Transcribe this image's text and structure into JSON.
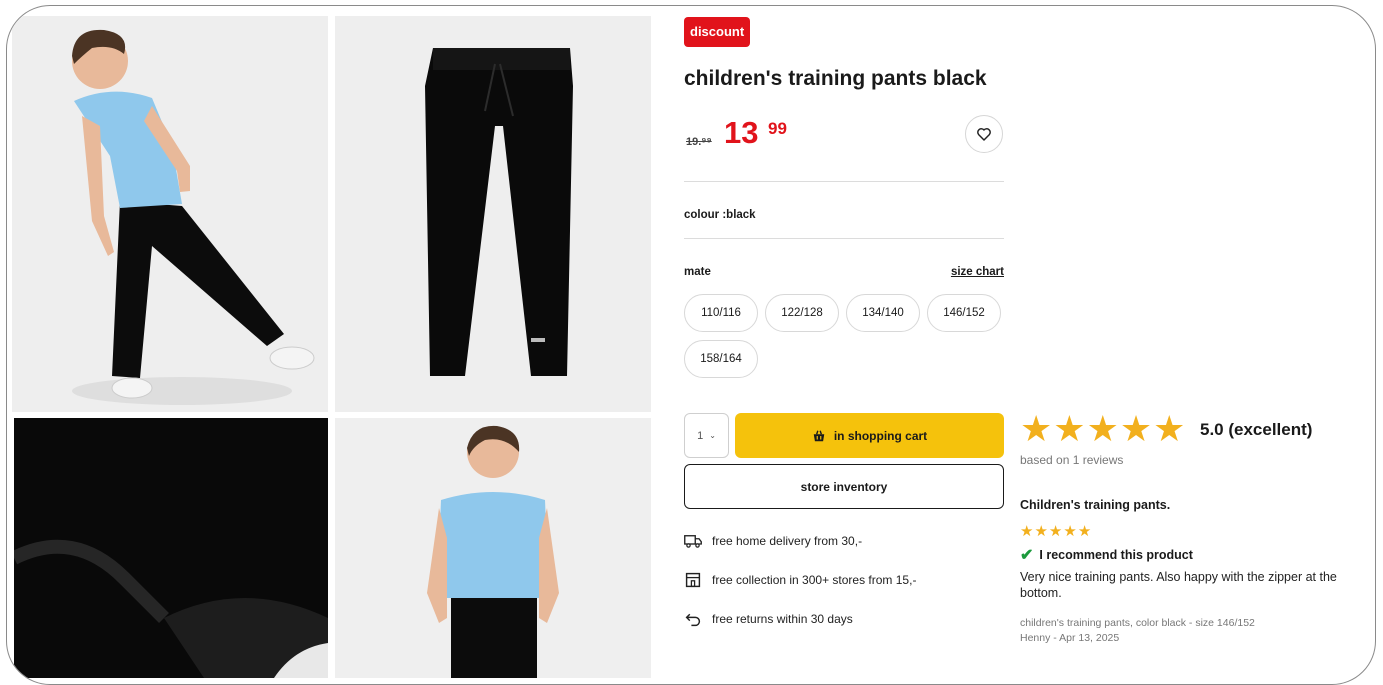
{
  "product": {
    "badge": "discount",
    "title": "children's training pants black",
    "price_old": "19.⁹⁹",
    "price_main": "13",
    "price_cents": "99",
    "favorite_icon": "heart-icon",
    "colour_label": "colour :black",
    "size_label": "mate",
    "size_chart": "size chart",
    "sizes": [
      "110/116",
      "122/128",
      "134/140",
      "146/152",
      "158/164"
    ],
    "quantity": "1",
    "cart_button": "in shopping cart",
    "store_button": "store inventory",
    "perks": [
      {
        "icon": "truck-icon",
        "text": "free home delivery from 30,-"
      },
      {
        "icon": "store-icon",
        "text": "free collection in 300+ stores from 15,-"
      },
      {
        "icon": "return-icon",
        "text": "free returns within 30 days"
      }
    ],
    "colors": {
      "accent": "#e1131b",
      "cart": "#f5c20c",
      "star": "#f2b01e"
    }
  },
  "reviews": {
    "rating_stars": 5,
    "score": "5.0 (excellent)",
    "based_on": "based on 1 reviews",
    "review": {
      "title": "Children's training pants.",
      "stars": 5,
      "recommend": "I recommend this product",
      "body": "Very nice training pants. Also happy with the zipper at the bottom.",
      "meta_line1": "children's training pants, color black - size 146/152",
      "meta_line2": "Henny - Apr 13, 2025"
    }
  }
}
